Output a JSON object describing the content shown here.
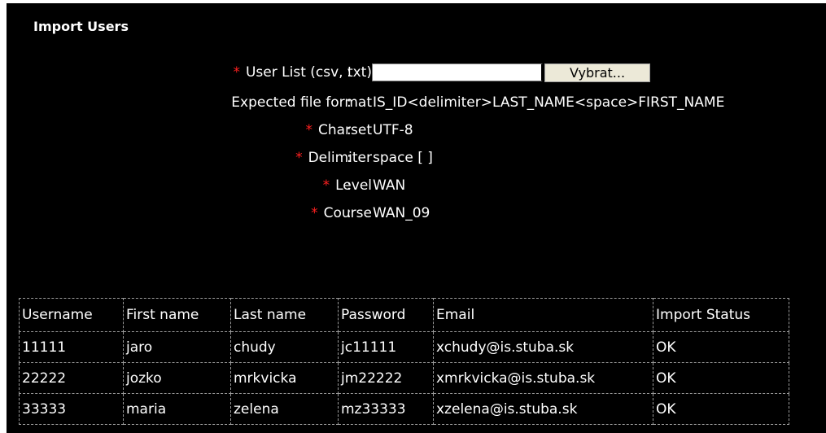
{
  "page": {
    "title": "Import Users"
  },
  "form": {
    "user_list": {
      "label": "User List (csv, txt)",
      "value": "",
      "browse_label": "Vybrat..."
    },
    "file_format": {
      "label": "Expected file format",
      "value": "IS_ID<delimiter>LAST_NAME<space>FIRST_NAME"
    },
    "charset": {
      "label": "Charset",
      "value": "UTF-8"
    },
    "delimiter": {
      "label": "Delimiter",
      "value": "space [ ]"
    },
    "level": {
      "label": "Level",
      "value": "WAN"
    },
    "course": {
      "label": "Course",
      "value": "WAN_09"
    },
    "required_marker": "*",
    "colon": ":"
  },
  "table": {
    "columns": [
      "Username",
      "First name",
      "Last name",
      "Password",
      "Email",
      "Import Status"
    ],
    "rows": [
      [
        "11111",
        "jaro",
        "chudy",
        "jc11111",
        "xchudy@is.stuba.sk",
        "OK"
      ],
      [
        "22222",
        "jozko",
        "mrkvicka",
        "jm22222",
        "xmrkvicka@is.stuba.sk",
        "OK"
      ],
      [
        "33333",
        "maria",
        "zelena",
        "mz33333",
        "xzelena@is.stuba.sk",
        "OK"
      ]
    ]
  },
  "colors": {
    "background": "#000000",
    "text": "#ffffff",
    "required": "#ff2020",
    "table_border": "#9a9a9a"
  }
}
